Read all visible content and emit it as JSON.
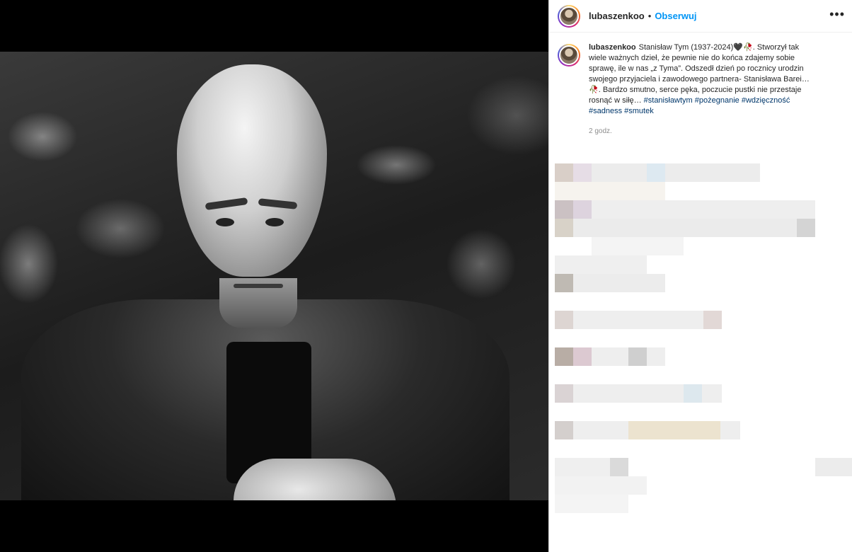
{
  "post": {
    "username": "lubaszenkoo",
    "separator": "•",
    "follow_label": "Obserwuj",
    "more_icon": "•••"
  },
  "caption": {
    "username": "lubaszenkoo",
    "text_1": "Stanisław Tym (1937-2024)",
    "emoji_1": "🖤🥀",
    "text_2": ". Stworzył tak wiele ważnych dzieł, że pewnie nie do końca zdajemy sobie sprawę, ile w nas „z Tyma”. Odszedł dzień po rocznicy urodzin swojego przyjaciela i zawodowego partnera- Stanisława Barei…",
    "emoji_2": "🥀",
    "text_3": ". Bardzo smutno, serce pęka, poczucie pustki nie przestaje rosnąć w siłę…",
    "hashtags": [
      "#stanisławtym",
      "#pożegnanie",
      "#wdzięczność",
      "#sadness",
      "#smutek"
    ],
    "timestamp": "2 godz."
  },
  "colors": {
    "follow": "#0095f6",
    "hashtag": "#00376b",
    "timestamp": "#8e8e8e"
  }
}
